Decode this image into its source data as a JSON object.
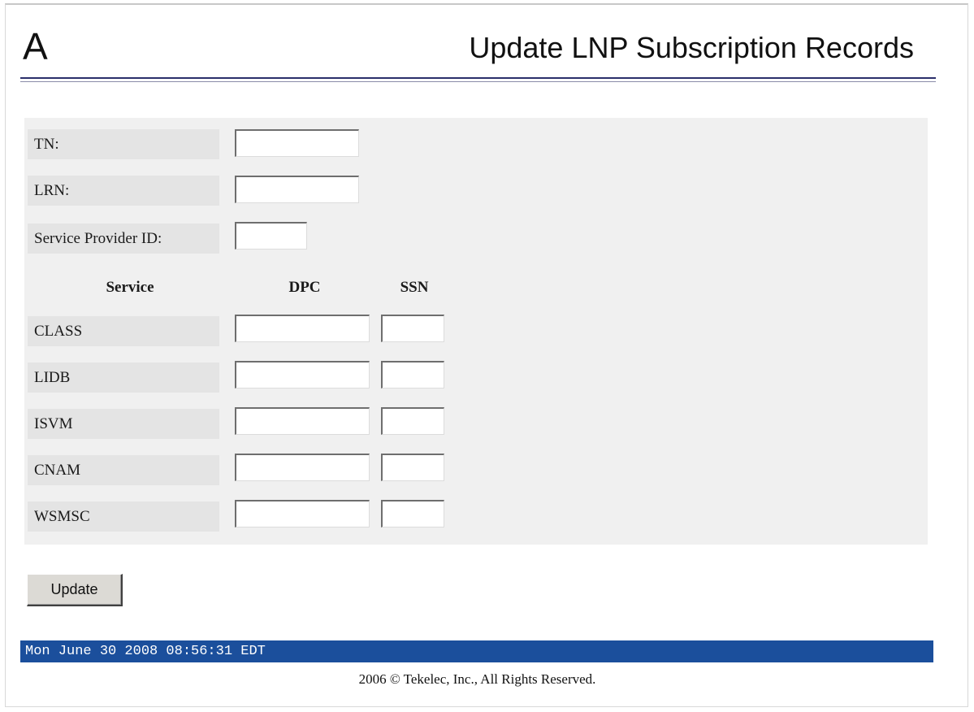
{
  "header": {
    "brand_letter": "A",
    "title": "Update LNP Subscription Records"
  },
  "form": {
    "tn": {
      "label": "TN:",
      "value": ""
    },
    "lrn": {
      "label": "LRN:",
      "value": ""
    },
    "spid": {
      "label": "Service Provider ID:",
      "value": ""
    },
    "columns": {
      "service": "Service",
      "dpc": "DPC",
      "ssn": "SSN"
    },
    "services": [
      {
        "name": "CLASS",
        "dpc": "",
        "ssn": ""
      },
      {
        "name": "LIDB",
        "dpc": "",
        "ssn": ""
      },
      {
        "name": "ISVM",
        "dpc": "",
        "ssn": ""
      },
      {
        "name": "CNAM",
        "dpc": "",
        "ssn": ""
      },
      {
        "name": "WSMSC",
        "dpc": "",
        "ssn": ""
      }
    ],
    "update_label": "Update"
  },
  "status_bar": {
    "datetime": "Mon June 30 2008 08:56:31 EDT"
  },
  "footer": {
    "copyright": "2006 © Tekelec, Inc., All Rights Reserved."
  },
  "colors": {
    "status_bar_bg": "#1b4f9c",
    "header_rule": "#2b2f6b",
    "panel_bg": "#f0f0f0"
  }
}
